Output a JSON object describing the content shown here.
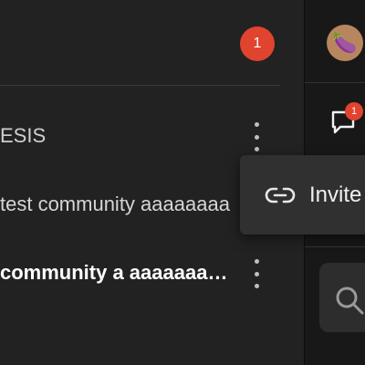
{
  "header": {
    "notification_count": "1"
  },
  "communities": [
    {
      "label": "ESIS"
    },
    {
      "label": "test community aaaaaaaa"
    },
    {
      "label": "community a aaaaaaa…"
    }
  ],
  "context_menu": {
    "items": [
      {
        "label": "Invite",
        "icon": "link-icon"
      }
    ]
  },
  "right_rail": {
    "avatar_emoji": "🍆",
    "chat_badge_count": "1",
    "icons": [
      "chat-icon",
      "search-icon"
    ]
  },
  "colors": {
    "badge": "#e0442f",
    "panel": "#222222",
    "popup": "#303030"
  }
}
